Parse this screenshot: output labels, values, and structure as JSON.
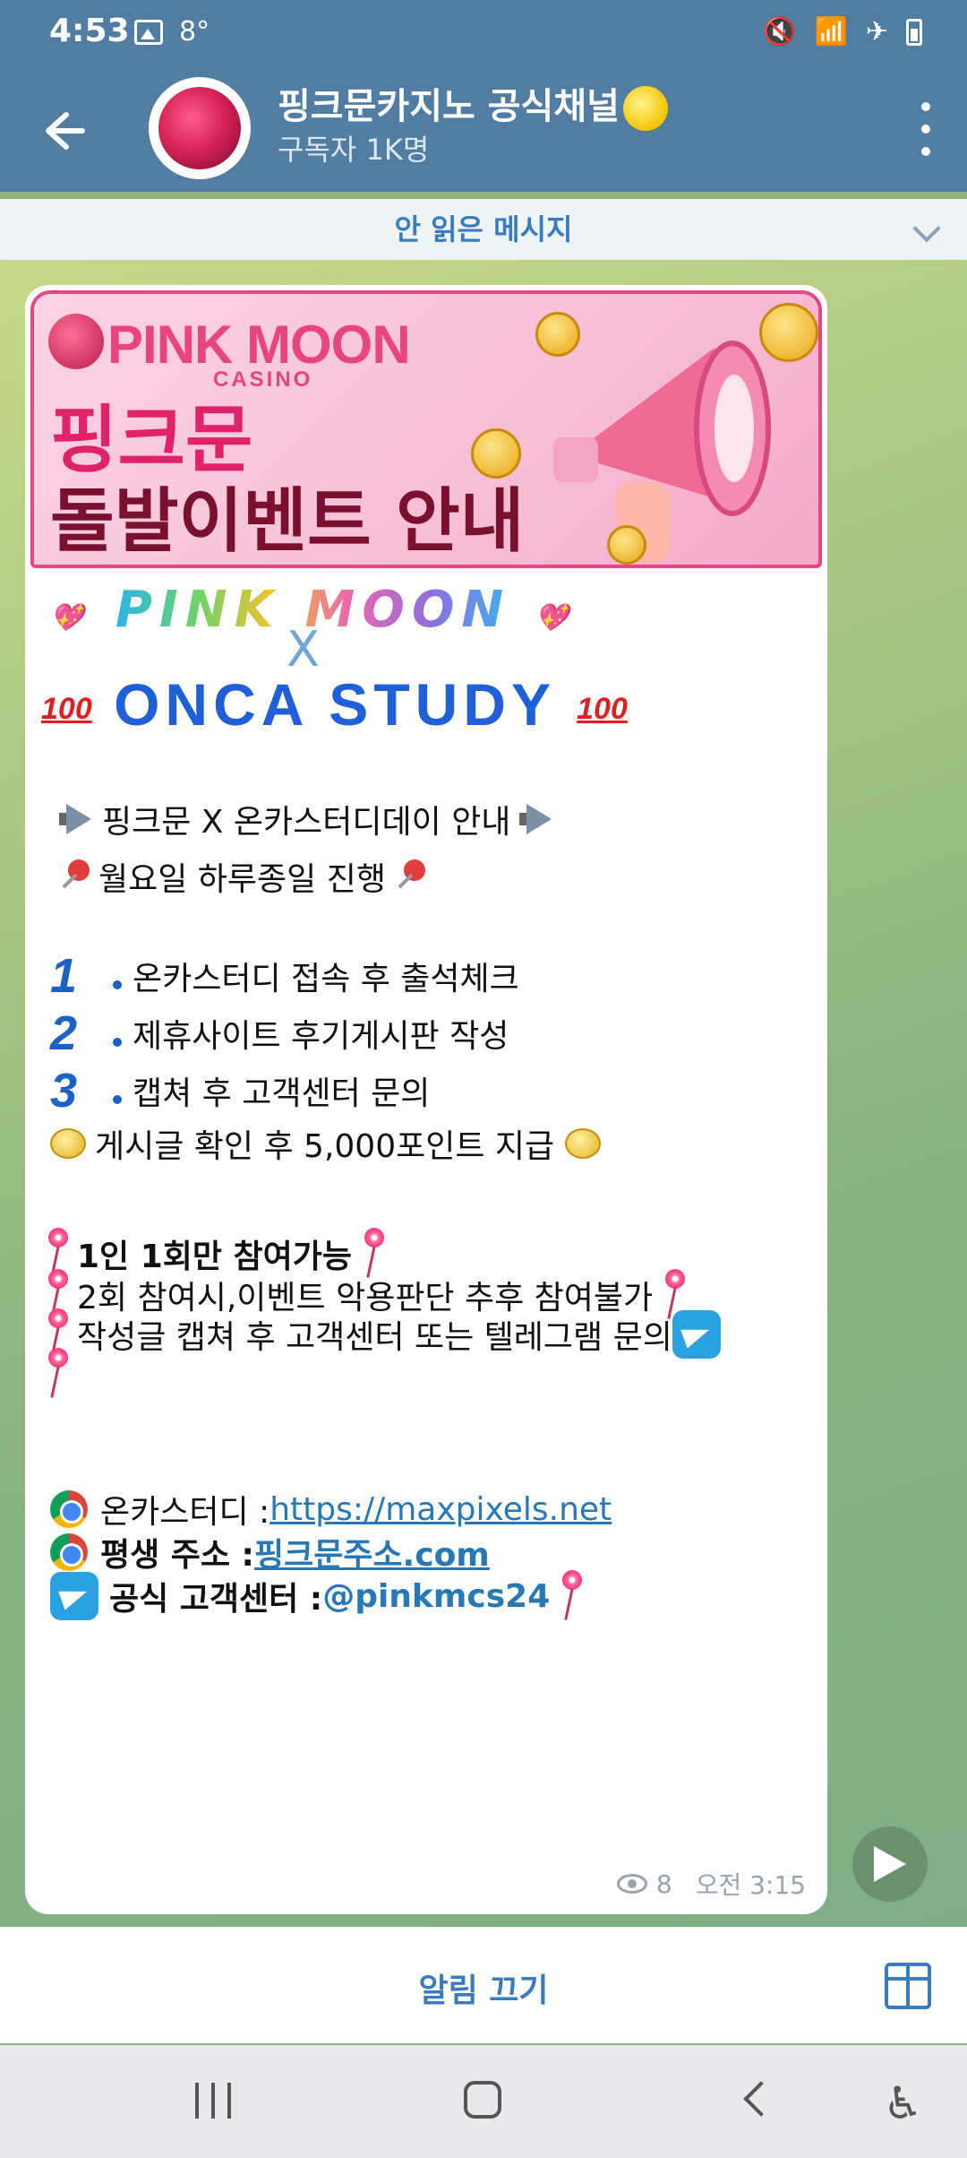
{
  "status_bar": {
    "time": "4:53",
    "temp": "8°",
    "icons": [
      "image-icon",
      "mute-icon",
      "wifi-icon",
      "airplane-icon",
      "battery-icon"
    ]
  },
  "header": {
    "title": "핑크문카지노 공식채널",
    "subtitle": "구독자 1K명"
  },
  "unread_label": "안 읽은 메시지",
  "banner": {
    "brand": "PINK MOON",
    "brand_sub": "CASINO",
    "headline_1": "핑크문",
    "headline_2": "돌발이벤트 안내"
  },
  "message": {
    "fancy_title": "PINK MOON",
    "x_mark": "X",
    "onca_title": "ONCA STUDY",
    "badge_100": "100",
    "intro_line": "핑크문 X 온카스터디데이 안내",
    "day_line": "월요일 하루종일 진행",
    "steps": [
      {
        "num": "1",
        "text": "온카스터디 접속 후 출석체크"
      },
      {
        "num": "2",
        "text": "제휴사이트 후기게시판 작성"
      },
      {
        "num": "3",
        "text": "캡쳐 후 고객센터 문의"
      }
    ],
    "reward_line": "게시글 확인 후 5,000포인트 지급",
    "rule_1": "1인 1회만 참여가능",
    "rule_2": "2회 참여시,이벤트 악용판단 추후 참여불가",
    "rule_3": "작성글 캡쳐 후 고객센터 또는 텔레그램 문의",
    "links": {
      "onca_label": "온카스터디 : ",
      "onca_url": "https://maxpixels.net",
      "lifetime_label": "평생 주소 : ",
      "lifetime_url": "핑크문주소.com",
      "cs_label": "공식 고객센터 : ",
      "cs_handle": "@pinkmcs24"
    },
    "views": "8",
    "time": "오전 3:15"
  },
  "bottom_bar": {
    "mute_label": "알림 끄기"
  },
  "colors": {
    "header": "#517da2",
    "accent": "#3a7bbf",
    "link": "#2678b6",
    "brand_pink": "#e0226b"
  }
}
